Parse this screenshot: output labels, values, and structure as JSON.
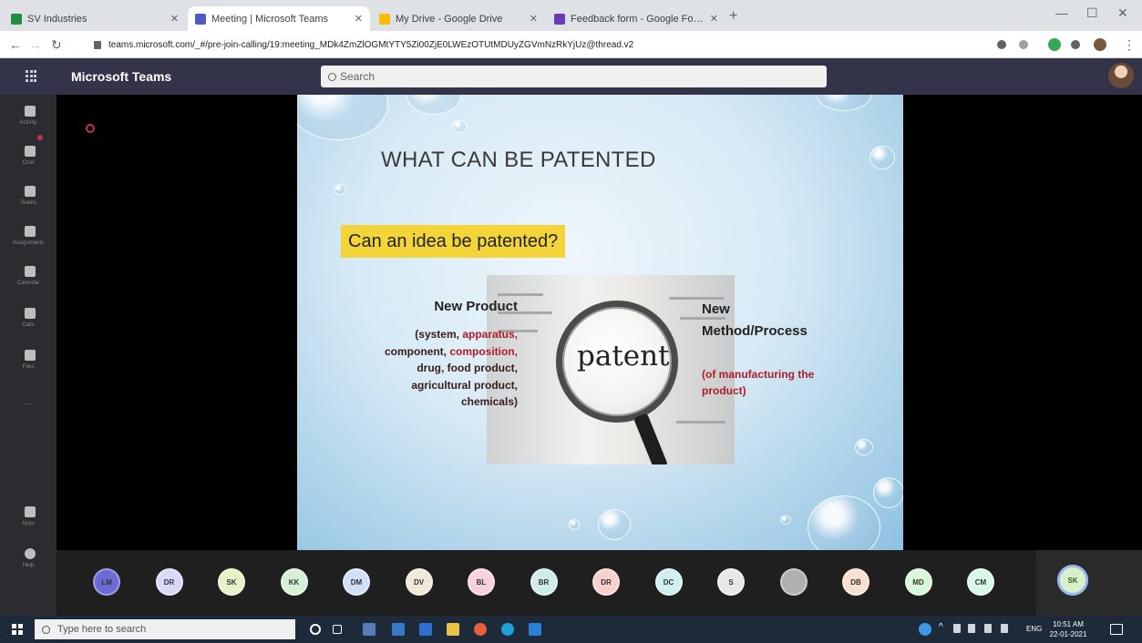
{
  "browser": {
    "tabs": [
      {
        "label": "SV Industries",
        "active": false,
        "color": "#1e8e3e"
      },
      {
        "label": "Meeting | Microsoft Teams",
        "active": true,
        "color": "#5059c9"
      },
      {
        "label": "My Drive - Google Drive",
        "active": false,
        "color": "#fbbc04"
      },
      {
        "label": "Feedback form - Google Forms",
        "active": false,
        "color": "#673ab7"
      }
    ],
    "url": "teams.microsoft.com/_#/pre-join-calling/19:meeting_MDk4ZmZlOGMtYTY5Zi00ZjE0LWEzOTUtMDUyZGVmNzRkYjUz@thread.v2"
  },
  "teams": {
    "title": "Microsoft Teams",
    "search_placeholder": "Search"
  },
  "rail": {
    "items": [
      "Activity",
      "Chat",
      "Teams",
      "Assignments",
      "Calendar",
      "Calls",
      "Files",
      "...",
      "Apps",
      "Help"
    ]
  },
  "slide": {
    "title": "WHAT CAN BE PATENTED",
    "question": "Can an idea be patented?",
    "image_word": "patent",
    "product": {
      "heading": "New Product",
      "lines": [
        {
          "parts": [
            {
              "t": "(system, ",
              "hl": false
            },
            {
              "t": "apparatus,",
              "hl": true
            }
          ]
        },
        {
          "parts": [
            {
              "t": "component, ",
              "hl": false
            },
            {
              "t": "composition,",
              "hl": true
            }
          ]
        },
        {
          "parts": [
            {
              "t": "drug, food product,",
              "hl": false
            }
          ]
        },
        {
          "parts": [
            {
              "t": "agricultural product,",
              "hl": false
            }
          ]
        },
        {
          "parts": [
            {
              "t": "chemicals)",
              "hl": false
            }
          ]
        }
      ]
    },
    "method": {
      "heading_line1": "New",
      "heading_line2": "Method/Process",
      "sub_line1": "(of manufacturing the",
      "sub_line2": "product)"
    }
  },
  "participants": [
    {
      "initials": "LM",
      "color": "#6b6bd6"
    },
    {
      "initials": "DR",
      "color": "#d8d8f8"
    },
    {
      "initials": "SK",
      "color": "#e6f2c8"
    },
    {
      "initials": "KK",
      "color": "#d6f0d6"
    },
    {
      "initials": "DM",
      "color": "#d0e0f8"
    },
    {
      "initials": "DV",
      "color": "#f0e8d8"
    },
    {
      "initials": "BL",
      "color": "#f8d0e0"
    },
    {
      "initials": "BR",
      "color": "#d0ece8"
    },
    {
      "initials": "DR",
      "color": "#f8d0d0"
    },
    {
      "initials": "DC",
      "color": "#d0f0f0"
    },
    {
      "initials": "S",
      "color": "#e8e8e8"
    },
    {
      "initials": "",
      "color": "#b0b0b0"
    },
    {
      "initials": "DB",
      "color": "#f8e0d0"
    },
    {
      "initials": "MD",
      "color": "#d8f8d8"
    },
    {
      "initials": "CM",
      "color": "#d8f8e8"
    }
  ],
  "self": {
    "initials": "SK"
  },
  "taskbar": {
    "search_placeholder": "Type here to search",
    "lang": "ENG",
    "time": "10:51 AM",
    "date": "22-01-2021"
  }
}
